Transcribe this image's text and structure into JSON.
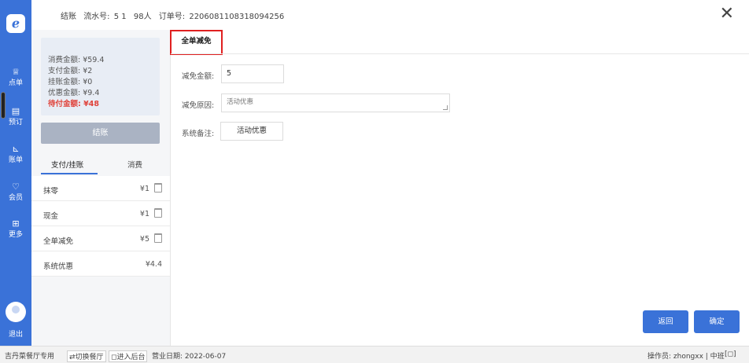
{
  "header": {
    "title": "结账",
    "serial_label": "流水号:",
    "serial_value": "5 1",
    "guests": "98人",
    "order_label": "订单号:",
    "order_number": "2206081108318094256"
  },
  "nav": {
    "items": [
      {
        "icon": "♕",
        "label": "点单"
      },
      {
        "icon": "▤",
        "label": "预订"
      },
      {
        "icon": "⊾",
        "label": "账单"
      },
      {
        "icon": "♡",
        "label": "会员"
      },
      {
        "icon": "⊞",
        "label": "更多"
      }
    ],
    "logout": "退出"
  },
  "summary": {
    "consumption": "消费金额: ¥59.4",
    "paid": "支付金额: ¥2",
    "credit": "挂账金额: ¥0",
    "discount": "优惠金额: ¥9.4",
    "due": "待付金额: ¥48"
  },
  "settle_button": "结账",
  "tabs": {
    "pay": "支付/挂账",
    "consume": "消费"
  },
  "payments": [
    {
      "name": "抹零",
      "amount": "¥1"
    },
    {
      "name": "现金",
      "amount": "¥1"
    },
    {
      "name": "全单减免",
      "amount": "¥5"
    },
    {
      "name": "系统优惠",
      "amount": "¥4.4"
    }
  ],
  "form": {
    "tab": "全单减免",
    "amount_label": "减免金额:",
    "amount_value": "5",
    "reason_label": "减免原因:",
    "reason_value": "活动优惠",
    "remark_label": "系统备注:",
    "remark_value": "活动优惠"
  },
  "buttons": {
    "back": "返回",
    "confirm": "确定"
  },
  "status_bar": {
    "store": "吉丹菜餐厅专用",
    "switch": "⇄切换餐厅",
    "backend": "◻进入后台",
    "business_date": "营业日期: 2022-06-07",
    "operator": "操作员: zhongxx | 中班",
    "icon": "[◻]"
  }
}
